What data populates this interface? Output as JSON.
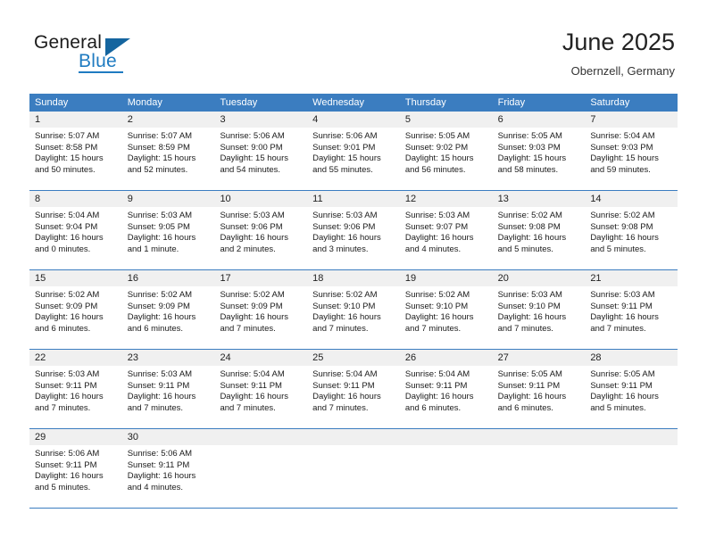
{
  "brand": {
    "name_top": "General",
    "name_bottom": "Blue"
  },
  "header": {
    "title": "June 2025",
    "subtitle": "Obernzell, Germany"
  },
  "calendar": {
    "weekday_headers": [
      "Sunday",
      "Monday",
      "Tuesday",
      "Wednesday",
      "Thursday",
      "Friday",
      "Saturday"
    ],
    "colors": {
      "header_blue": "#3b7dc0",
      "day_band_gray": "#f0f0f0",
      "brand_blue": "#1f7bc1"
    },
    "weeks": [
      [
        {
          "day": "",
          "empty": true,
          "sunrise": "",
          "sunset": "",
          "daylight_line1": "",
          "daylight_line2": ""
        },
        {
          "day": "",
          "empty": true,
          "sunrise": "",
          "sunset": "",
          "daylight_line1": "",
          "daylight_line2": ""
        },
        {
          "day": "",
          "empty": true,
          "sunrise": "",
          "sunset": "",
          "daylight_line1": "",
          "daylight_line2": ""
        },
        {
          "day": "",
          "empty": true,
          "sunrise": "",
          "sunset": "",
          "daylight_line1": "",
          "daylight_line2": ""
        },
        {
          "day": "",
          "empty": true,
          "sunrise": "",
          "sunset": "",
          "daylight_line1": "",
          "daylight_line2": ""
        },
        {
          "day": "",
          "empty": true,
          "sunrise": "",
          "sunset": "",
          "daylight_line1": "",
          "daylight_line2": ""
        },
        {
          "day": "",
          "empty": true,
          "sunrise": "",
          "sunset": "",
          "daylight_line1": "",
          "daylight_line2": ""
        }
      ],
      [
        {
          "day": "1",
          "sunrise": "Sunrise: 5:07 AM",
          "sunset": "Sunset: 8:58 PM",
          "daylight_line1": "Daylight: 15 hours",
          "daylight_line2": "and 50 minutes."
        },
        {
          "day": "2",
          "sunrise": "Sunrise: 5:07 AM",
          "sunset": "Sunset: 8:59 PM",
          "daylight_line1": "Daylight: 15 hours",
          "daylight_line2": "and 52 minutes."
        },
        {
          "day": "3",
          "sunrise": "Sunrise: 5:06 AM",
          "sunset": "Sunset: 9:00 PM",
          "daylight_line1": "Daylight: 15 hours",
          "daylight_line2": "and 54 minutes."
        },
        {
          "day": "4",
          "sunrise": "Sunrise: 5:06 AM",
          "sunset": "Sunset: 9:01 PM",
          "daylight_line1": "Daylight: 15 hours",
          "daylight_line2": "and 55 minutes."
        },
        {
          "day": "5",
          "sunrise": "Sunrise: 5:05 AM",
          "sunset": "Sunset: 9:02 PM",
          "daylight_line1": "Daylight: 15 hours",
          "daylight_line2": "and 56 minutes."
        },
        {
          "day": "6",
          "sunrise": "Sunrise: 5:05 AM",
          "sunset": "Sunset: 9:03 PM",
          "daylight_line1": "Daylight: 15 hours",
          "daylight_line2": "and 58 minutes."
        },
        {
          "day": "7",
          "sunrise": "Sunrise: 5:04 AM",
          "sunset": "Sunset: 9:03 PM",
          "daylight_line1": "Daylight: 15 hours",
          "daylight_line2": "and 59 minutes."
        }
      ],
      [
        {
          "day": "8",
          "sunrise": "Sunrise: 5:04 AM",
          "sunset": "Sunset: 9:04 PM",
          "daylight_line1": "Daylight: 16 hours",
          "daylight_line2": "and 0 minutes."
        },
        {
          "day": "9",
          "sunrise": "Sunrise: 5:03 AM",
          "sunset": "Sunset: 9:05 PM",
          "daylight_line1": "Daylight: 16 hours",
          "daylight_line2": "and 1 minute."
        },
        {
          "day": "10",
          "sunrise": "Sunrise: 5:03 AM",
          "sunset": "Sunset: 9:06 PM",
          "daylight_line1": "Daylight: 16 hours",
          "daylight_line2": "and 2 minutes."
        },
        {
          "day": "11",
          "sunrise": "Sunrise: 5:03 AM",
          "sunset": "Sunset: 9:06 PM",
          "daylight_line1": "Daylight: 16 hours",
          "daylight_line2": "and 3 minutes."
        },
        {
          "day": "12",
          "sunrise": "Sunrise: 5:03 AM",
          "sunset": "Sunset: 9:07 PM",
          "daylight_line1": "Daylight: 16 hours",
          "daylight_line2": "and 4 minutes."
        },
        {
          "day": "13",
          "sunrise": "Sunrise: 5:02 AM",
          "sunset": "Sunset: 9:08 PM",
          "daylight_line1": "Daylight: 16 hours",
          "daylight_line2": "and 5 minutes."
        },
        {
          "day": "14",
          "sunrise": "Sunrise: 5:02 AM",
          "sunset": "Sunset: 9:08 PM",
          "daylight_line1": "Daylight: 16 hours",
          "daylight_line2": "and 5 minutes."
        }
      ],
      [
        {
          "day": "15",
          "sunrise": "Sunrise: 5:02 AM",
          "sunset": "Sunset: 9:09 PM",
          "daylight_line1": "Daylight: 16 hours",
          "daylight_line2": "and 6 minutes."
        },
        {
          "day": "16",
          "sunrise": "Sunrise: 5:02 AM",
          "sunset": "Sunset: 9:09 PM",
          "daylight_line1": "Daylight: 16 hours",
          "daylight_line2": "and 6 minutes."
        },
        {
          "day": "17",
          "sunrise": "Sunrise: 5:02 AM",
          "sunset": "Sunset: 9:09 PM",
          "daylight_line1": "Daylight: 16 hours",
          "daylight_line2": "and 7 minutes."
        },
        {
          "day": "18",
          "sunrise": "Sunrise: 5:02 AM",
          "sunset": "Sunset: 9:10 PM",
          "daylight_line1": "Daylight: 16 hours",
          "daylight_line2": "and 7 minutes."
        },
        {
          "day": "19",
          "sunrise": "Sunrise: 5:02 AM",
          "sunset": "Sunset: 9:10 PM",
          "daylight_line1": "Daylight: 16 hours",
          "daylight_line2": "and 7 minutes."
        },
        {
          "day": "20",
          "sunrise": "Sunrise: 5:03 AM",
          "sunset": "Sunset: 9:10 PM",
          "daylight_line1": "Daylight: 16 hours",
          "daylight_line2": "and 7 minutes."
        },
        {
          "day": "21",
          "sunrise": "Sunrise: 5:03 AM",
          "sunset": "Sunset: 9:11 PM",
          "daylight_line1": "Daylight: 16 hours",
          "daylight_line2": "and 7 minutes."
        }
      ],
      [
        {
          "day": "22",
          "sunrise": "Sunrise: 5:03 AM",
          "sunset": "Sunset: 9:11 PM",
          "daylight_line1": "Daylight: 16 hours",
          "daylight_line2": "and 7 minutes."
        },
        {
          "day": "23",
          "sunrise": "Sunrise: 5:03 AM",
          "sunset": "Sunset: 9:11 PM",
          "daylight_line1": "Daylight: 16 hours",
          "daylight_line2": "and 7 minutes."
        },
        {
          "day": "24",
          "sunrise": "Sunrise: 5:04 AM",
          "sunset": "Sunset: 9:11 PM",
          "daylight_line1": "Daylight: 16 hours",
          "daylight_line2": "and 7 minutes."
        },
        {
          "day": "25",
          "sunrise": "Sunrise: 5:04 AM",
          "sunset": "Sunset: 9:11 PM",
          "daylight_line1": "Daylight: 16 hours",
          "daylight_line2": "and 7 minutes."
        },
        {
          "day": "26",
          "sunrise": "Sunrise: 5:04 AM",
          "sunset": "Sunset: 9:11 PM",
          "daylight_line1": "Daylight: 16 hours",
          "daylight_line2": "and 6 minutes."
        },
        {
          "day": "27",
          "sunrise": "Sunrise: 5:05 AM",
          "sunset": "Sunset: 9:11 PM",
          "daylight_line1": "Daylight: 16 hours",
          "daylight_line2": "and 6 minutes."
        },
        {
          "day": "28",
          "sunrise": "Sunrise: 5:05 AM",
          "sunset": "Sunset: 9:11 PM",
          "daylight_line1": "Daylight: 16 hours",
          "daylight_line2": "and 5 minutes."
        }
      ],
      [
        {
          "day": "29",
          "sunrise": "Sunrise: 5:06 AM",
          "sunset": "Sunset: 9:11 PM",
          "daylight_line1": "Daylight: 16 hours",
          "daylight_line2": "and 5 minutes."
        },
        {
          "day": "30",
          "sunrise": "Sunrise: 5:06 AM",
          "sunset": "Sunset: 9:11 PM",
          "daylight_line1": "Daylight: 16 hours",
          "daylight_line2": "and 4 minutes."
        },
        {
          "day": "",
          "empty": true,
          "sunrise": "",
          "sunset": "",
          "daylight_line1": "",
          "daylight_line2": ""
        },
        {
          "day": "",
          "empty": true,
          "sunrise": "",
          "sunset": "",
          "daylight_line1": "",
          "daylight_line2": ""
        },
        {
          "day": "",
          "empty": true,
          "sunrise": "",
          "sunset": "",
          "daylight_line1": "",
          "daylight_line2": ""
        },
        {
          "day": "",
          "empty": true,
          "sunrise": "",
          "sunset": "",
          "daylight_line1": "",
          "daylight_line2": ""
        },
        {
          "day": "",
          "empty": true,
          "sunrise": "",
          "sunset": "",
          "daylight_line1": "",
          "daylight_line2": ""
        }
      ]
    ]
  }
}
